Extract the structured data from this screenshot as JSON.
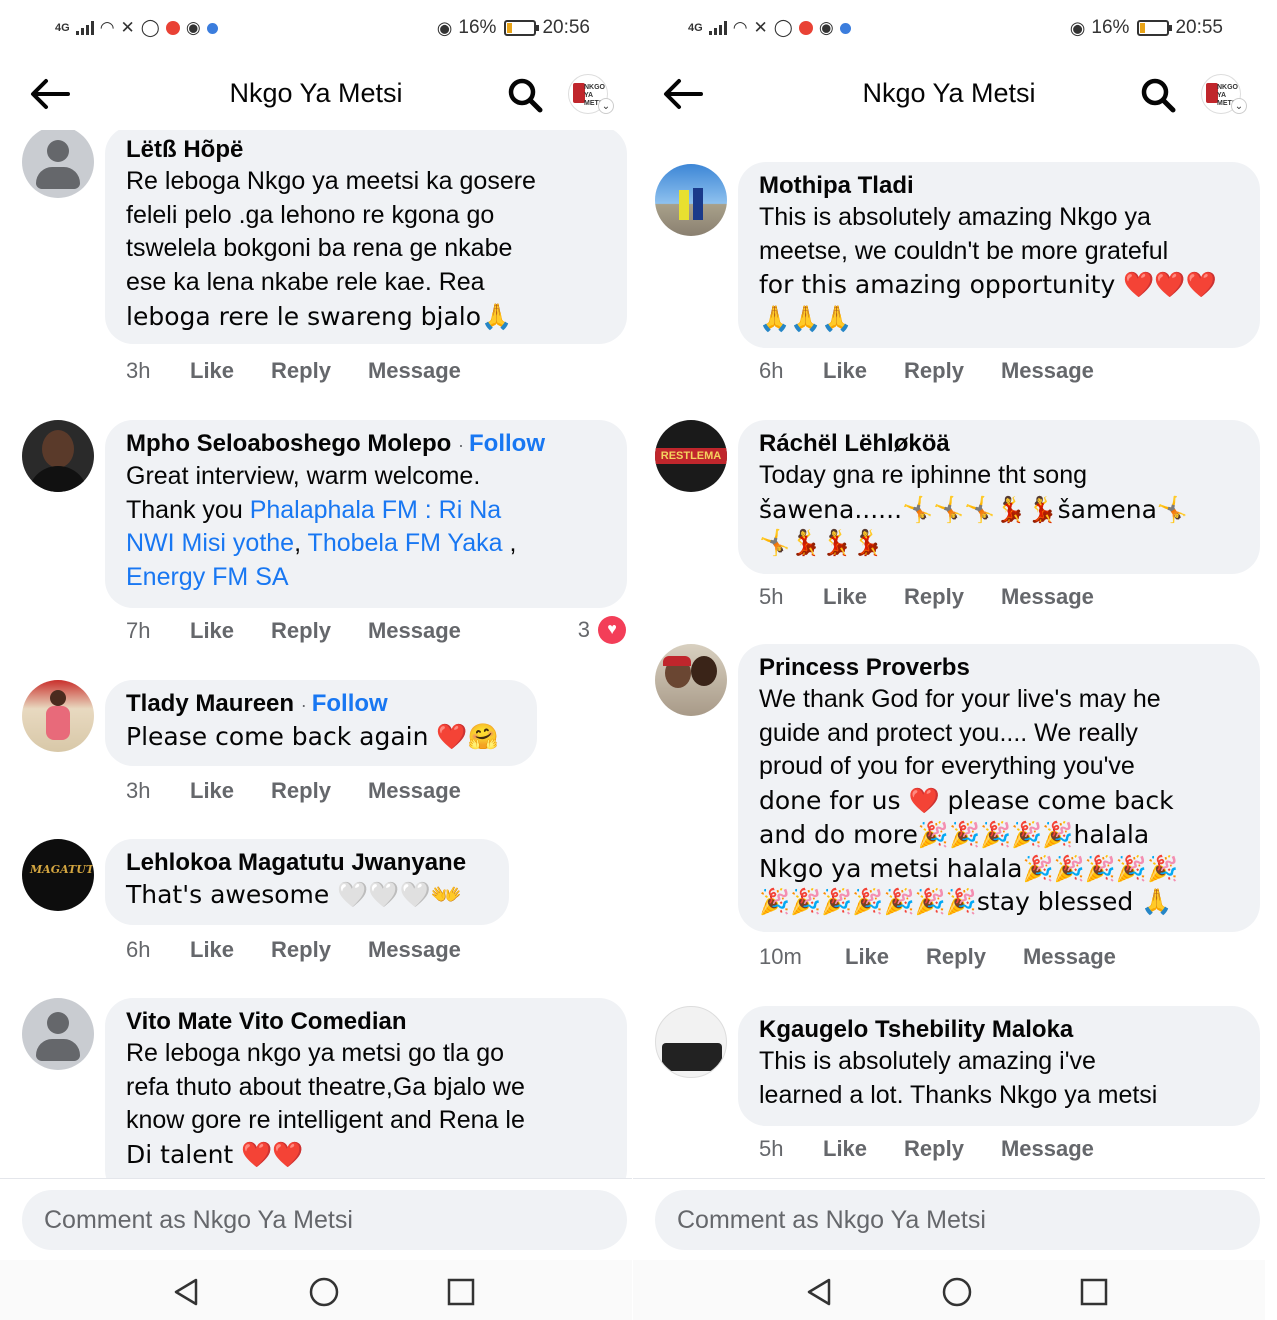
{
  "screens": [
    {
      "status": {
        "network": "4G",
        "battery_pct": "16%",
        "battery_level": 0.16,
        "time": "20:56"
      },
      "header": {
        "title": "Nkgo Ya Metsi",
        "back_icon": "back-arrow-icon",
        "search_icon": "search-icon",
        "avatar_text": "NKGO YA METSI"
      },
      "comments": [
        {
          "author": "Lëtß Hõpë",
          "follow": "",
          "text": [
            "Re leboga Nkgo ya meetsi ka gosere",
            "feleli pelo .ga lehono re kgona go",
            "tswelela  bokgoni ba rena ge nkabe",
            "ese ka lena nkabe rele kae. Rea",
            "leboga rere le swareng bjalo🙏"
          ],
          "time": "3h",
          "reactions": ""
        },
        {
          "author": "Mpho Seloaboshego Molepo",
          "follow": "Follow",
          "text_parts": [
            {
              "t": "Great interview, warm welcome.",
              "link": false,
              "br": true
            },
            {
              "t": "Thank you ",
              "link": false,
              "br": false
            },
            {
              "t": "Phalaphala FM : Ri Na",
              "link": true,
              "br": true
            },
            {
              "t": "NWI Misi yothe",
              "link": true,
              "br": false
            },
            {
              "t": ",  ",
              "link": false,
              "br": false
            },
            {
              "t": "Thobela FM Yaka",
              "link": true,
              "br": false
            },
            {
              "t": " ,",
              "link": false,
              "br": true
            },
            {
              "t": "Energy FM SA",
              "link": true,
              "br": false
            }
          ],
          "time": "7h",
          "reactions": "3"
        },
        {
          "author": "Tlady Maureen",
          "follow": "Follow",
          "text": [
            "Please come back again ❤️🤗"
          ],
          "time": "3h",
          "reactions": ""
        },
        {
          "author": "Lehlokoa Magatutu Jwanyane",
          "follow": "",
          "text": [
            "That's awesome 🤍🤍🤍👐"
          ],
          "time": "6h",
          "reactions": ""
        },
        {
          "author": "Vito Mate Vito Comedian",
          "follow": "",
          "text": [
            "Re leboga nkgo ya metsi go tla go",
            "refa thuto about theatre,Ga bjalo we",
            "know gore re intelligent and Rena le",
            "Di talent ❤️❤️"
          ],
          "time": "",
          "reactions": ""
        }
      ],
      "comment_placeholder": "Comment as Nkgo Ya Metsi"
    },
    {
      "status": {
        "network": "4G",
        "battery_pct": "16%",
        "battery_level": 0.16,
        "time": "20:55"
      },
      "header": {
        "title": "Nkgo Ya Metsi",
        "back_icon": "back-arrow-icon",
        "search_icon": "search-icon",
        "avatar_text": "NKGO YA METSI"
      },
      "comments": [
        {
          "author": "Mothipa Tladi",
          "follow": "",
          "text": [
            "This is absolutely amazing Nkgo ya",
            "meetse, we couldn't be more grateful",
            "for this amazing opportunity ❤️❤️❤️",
            "🙏🙏🙏"
          ],
          "time": "6h",
          "reactions": ""
        },
        {
          "author": "Ráchël Lëhløköä",
          "follow": "",
          "text": [
            "Today gna re iphinne tht song",
            "šawena......🤸🤸🤸💃💃šamena🤸",
            "🤸💃💃💃"
          ],
          "time": "5h",
          "reactions": ""
        },
        {
          "author": "Princess Proverbs",
          "follow": "",
          "text": [
            "We thank God for your live's may he",
            "guide and protect you.... We really",
            "proud of you for everything you've",
            "done for us ❤️ please come back",
            "and do more🎉🎉🎉🎉🎉halala",
            "Nkgo ya metsi halala🎉🎉🎉🎉🎉",
            "🎉🎉🎉🎉🎉🎉🎉stay blessed 🙏"
          ],
          "time": "10m",
          "reactions": ""
        },
        {
          "author": "Kgaugelo Tshebility Maloka",
          "follow": "",
          "text": [
            "This is absolutely amazing i've",
            "learned a lot. Thanks Nkgo ya metsi"
          ],
          "time": "5h",
          "reactions": ""
        }
      ],
      "comment_placeholder": "Comment as Nkgo Ya Metsi"
    }
  ],
  "actions": {
    "like": "Like",
    "reply": "Reply",
    "message": "Message"
  },
  "colors": {
    "link": "#1877f2",
    "bubble": "#f0f2f5",
    "meta": "#65676b",
    "heart": "#f33e58"
  }
}
